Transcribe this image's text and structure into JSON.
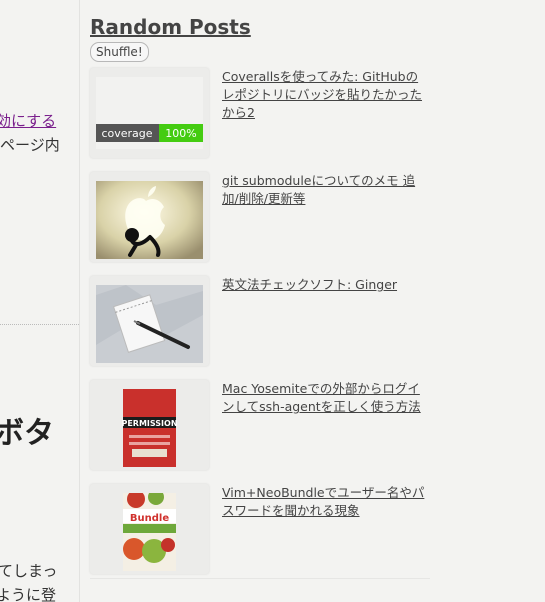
{
  "main": {
    "fragments": {
      "link": "効にする",
      "line1": "ページ内",
      "heading": "ボタ",
      "line2": "てしまっ",
      "line3": "ように登"
    }
  },
  "sidebar": {
    "widget_title": "Random Posts",
    "shuffle_label": "Shuffle!",
    "posts": [
      {
        "title": "Coverallsを使ってみた: GitHubのレポジトリにバッジを貼りたかったから2",
        "badge_left": "coverage",
        "badge_right": "100%"
      },
      {
        "title": "git submoduleについてのメモ 追加/削除/更新等"
      },
      {
        "title": "英文法チェックソフト: Ginger"
      },
      {
        "title": "Mac Yosemiteでの外部からログインしてssh-agentを正しく使う方法",
        "cover_text": "PERMISSION"
      },
      {
        "title": "Vim+NeoBundleでユーザー名やパスワードを聞かれる現象",
        "cover_text": "Bundle"
      }
    ]
  },
  "colors": {
    "background": "#f3f3f1",
    "link_visited": "#7a1f8c",
    "badge_green": "#44cc11",
    "badge_gray": "#555555"
  }
}
